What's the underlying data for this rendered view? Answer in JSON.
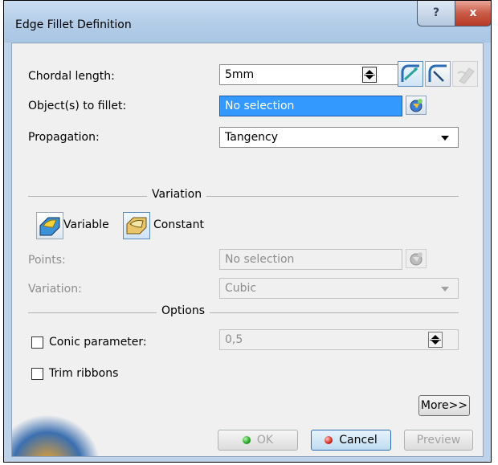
{
  "window": {
    "title": "Edge Fillet Definition",
    "help_label": "?",
    "close_label": "x"
  },
  "form": {
    "chordal_length": {
      "label": "Chordal length:",
      "value": "5mm"
    },
    "objects": {
      "label": "Object(s) to fillet:",
      "value": "No selection"
    },
    "propagation": {
      "label": "Propagation:",
      "value": "Tangency"
    }
  },
  "variation": {
    "section_title": "Variation",
    "variable_label": "Variable",
    "constant_label": "Constant",
    "points": {
      "label": "Points:",
      "value": "No selection"
    },
    "variation_mode": {
      "label": "Variation:",
      "value": "Cubic"
    }
  },
  "options": {
    "section_title": "Options",
    "conic_parameter": {
      "label": "Conic parameter:",
      "value": "0,5",
      "checked": false
    },
    "trim_ribbons": {
      "label": "Trim ribbons",
      "checked": false
    }
  },
  "buttons": {
    "more": "More>>",
    "ok": "OK",
    "cancel": "Cancel",
    "preview": "Preview"
  },
  "colors": {
    "accent": "#3399ff",
    "title_bar": "#b3cde8",
    "client_bg": "#f0f0f0",
    "close": "#c95b47"
  },
  "icons": [
    "chordal-fillet-icon",
    "chordal-length-icon",
    "setback-icon",
    "selector-icon",
    "variable-fillet-icon",
    "constant-fillet-icon",
    "combo-arrow-icon",
    "spinner-icon"
  ]
}
